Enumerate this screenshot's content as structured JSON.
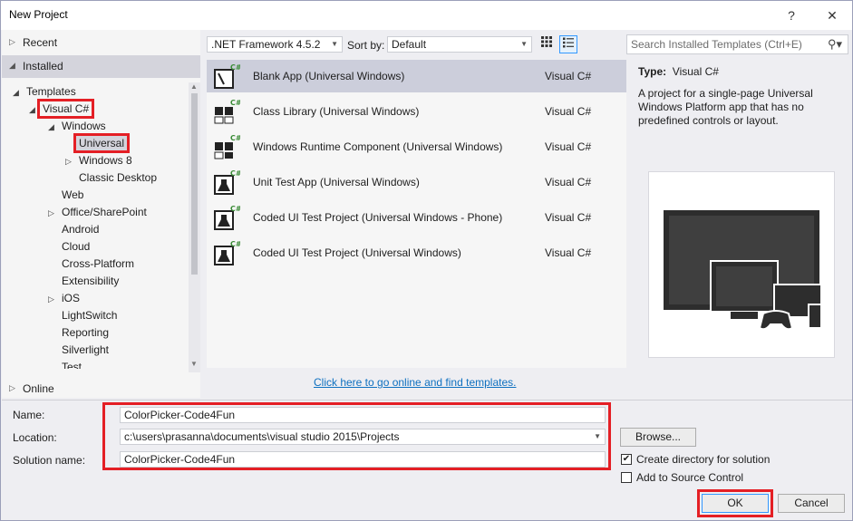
{
  "window": {
    "title": "New Project",
    "help": "?",
    "close": "✕"
  },
  "tree": {
    "recent": "Recent",
    "installed": "Installed",
    "online": "Online",
    "nodes": [
      {
        "label": "Templates",
        "twisty": "◢"
      },
      {
        "label": "Visual C#",
        "twisty": "◢"
      },
      {
        "label": "Windows",
        "twisty": "◢"
      },
      {
        "label": "Universal",
        "twisty": ""
      },
      {
        "label": "Windows 8",
        "twisty": "▷"
      },
      {
        "label": "Classic Desktop",
        "twisty": ""
      },
      {
        "label": "Web",
        "twisty": ""
      },
      {
        "label": "Office/SharePoint",
        "twisty": "▷"
      },
      {
        "label": "Android",
        "twisty": ""
      },
      {
        "label": "Cloud",
        "twisty": ""
      },
      {
        "label": "Cross-Platform",
        "twisty": ""
      },
      {
        "label": "Extensibility",
        "twisty": ""
      },
      {
        "label": "iOS",
        "twisty": "▷"
      },
      {
        "label": "LightSwitch",
        "twisty": ""
      },
      {
        "label": "Reporting",
        "twisty": ""
      },
      {
        "label": "Silverlight",
        "twisty": ""
      },
      {
        "label": "Test",
        "twisty": ""
      }
    ]
  },
  "toolbar": {
    "framework": ".NET Framework 4.5.2",
    "sort_label": "Sort by:",
    "sort_value": "Default"
  },
  "templates": [
    {
      "name": "Blank App (Universal Windows)",
      "lang": "Visual C#",
      "icon": "blank-app-icon"
    },
    {
      "name": "Class Library (Universal Windows)",
      "lang": "Visual C#",
      "icon": "class-library-icon"
    },
    {
      "name": "Windows Runtime Component (Universal Windows)",
      "lang": "Visual C#",
      "icon": "runtime-component-icon"
    },
    {
      "name": "Unit Test App (Universal Windows)",
      "lang": "Visual C#",
      "icon": "unit-test-icon"
    },
    {
      "name": "Coded UI Test Project (Universal Windows - Phone)",
      "lang": "Visual C#",
      "icon": "coded-ui-test-icon"
    },
    {
      "name": "Coded UI Test Project (Universal Windows)",
      "lang": "Visual C#",
      "icon": "coded-ui-test-icon"
    }
  ],
  "online_link": "Click here to go online and find templates.",
  "search": {
    "placeholder": "Search Installed Templates (Ctrl+E)"
  },
  "details": {
    "type_label": "Type:",
    "type_value": "Visual C#",
    "description": "A project for a single-page Universal Windows Platform app that has no predefined controls or layout."
  },
  "form": {
    "name_label": "Name:",
    "name_value": "ColorPicker-Code4Fun",
    "location_label": "Location:",
    "location_value": "c:\\users\\prasanna\\documents\\visual studio 2015\\Projects",
    "solution_label": "Solution name:",
    "solution_value": "ColorPicker-Code4Fun",
    "browse": "Browse...",
    "create_dir": "Create directory for solution",
    "add_source": "Add to Source Control",
    "ok": "OK",
    "cancel": "Cancel"
  },
  "colors": {
    "accent_red": "#e41f25",
    "selection": "#cccedb",
    "link": "#0e70c0"
  }
}
